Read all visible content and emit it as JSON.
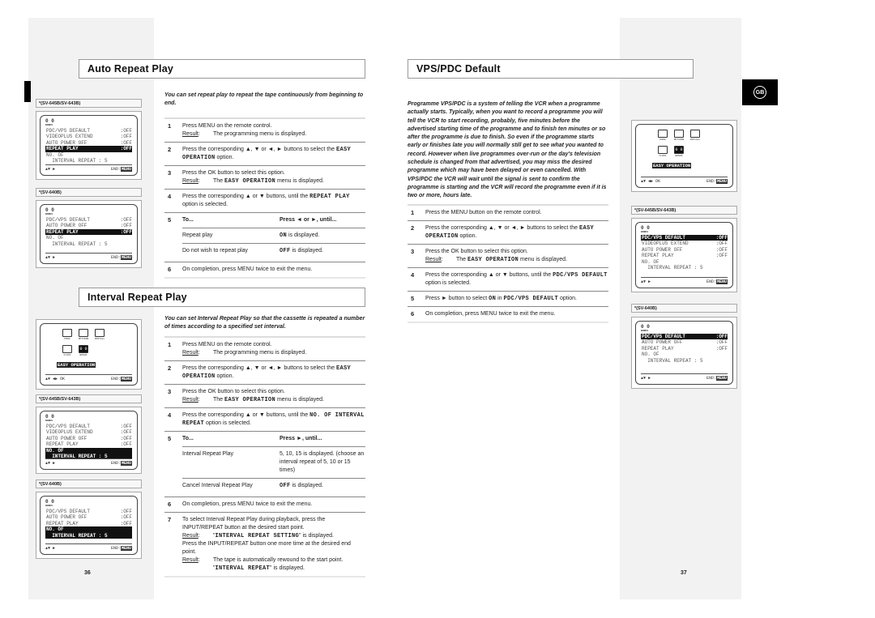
{
  "result_label": "Result",
  "left_page": {
    "page_number": "36",
    "auto_repeat": {
      "title": "Auto Repeat Play",
      "intro": "You can set repeat play to repeat the tape continuously from beginning to end.",
      "steps": [
        {
          "num": "1",
          "parts": [
            {
              "text": [
                "Press MENU on the remote control."
              ]
            },
            {
              "result": [
                "The programming menu is displayed."
              ]
            }
          ]
        },
        {
          "num": "2",
          "parts": [
            {
              "text": [
                "Press the corresponding ▲, ▼ or ◄, ► buttons to select the ",
                {
                  "m": "EASY OPERATION"
                },
                " option."
              ]
            }
          ]
        },
        {
          "num": "3",
          "parts": [
            {
              "text": [
                "Press the OK button to select this option."
              ]
            },
            {
              "result": [
                "The ",
                {
                  "m": "EASY OPERATION"
                },
                " menu is displayed."
              ]
            }
          ]
        },
        {
          "num": "4",
          "parts": [
            {
              "text": [
                "Press the corresponding ▲ or ▼ buttons, until the ",
                {
                  "m": "REPEAT PLAY"
                },
                " option is selected."
              ]
            }
          ]
        },
        {
          "num": "5",
          "table": {
            "head": [
              "To...",
              "Press ◄ or ►, until..."
            ],
            "rows": [
              [
                [
                  "Repeat play"
                ],
                [
                  {
                    "m": "ON"
                  },
                  " is displayed."
                ]
              ],
              [
                [
                  "Do not wish to repeat play"
                ],
                [
                  {
                    "m": "OFF"
                  },
                  " is displayed."
                ]
              ]
            ]
          }
        },
        {
          "num": "6",
          "parts": [
            {
              "text": [
                "On completion, press MENU twice to exit the menu."
              ]
            }
          ]
        }
      ],
      "screens": [
        {
          "label": "*(SV-645B/SV-643B)",
          "type": "menu",
          "rows": [
            [
              "PDC/VPS DEFAULT",
              ":OFF"
            ],
            [
              "VIDEOPLUS EXTEND",
              ":OFF"
            ],
            [
              "AUTO POWER OFF",
              ":OFF"
            ],
            [
              "REPEAT PLAY",
              ":OFF"
            ],
            [
              "NO. OF",
              ""
            ],
            [
              "  INTERVAL REPEAT : 5",
              ""
            ]
          ],
          "highlight": [
            3
          ]
        },
        {
          "label": "*(SV-640B)",
          "type": "menu",
          "rows": [
            [
              "PDC/VPS DEFAULT",
              ":OFF"
            ],
            [
              "AUTO POWER OFF",
              ":OFF"
            ],
            [
              "REPEAT PLAY",
              ":OFF"
            ],
            [
              "NO. OF",
              ""
            ],
            [
              "  INTERVAL REPEAT : 5",
              ""
            ]
          ],
          "highlight": [
            2
          ]
        }
      ]
    },
    "interval_repeat": {
      "title": "Interval Repeat Play",
      "intro": "You can set Interval Repeat Play so that the cassette is repeated a number of times according to a specified set interval.",
      "steps": [
        {
          "num": "1",
          "parts": [
            {
              "text": [
                "Press MENU on the remote control."
              ]
            },
            {
              "result": [
                "The programming menu is displayed."
              ]
            }
          ]
        },
        {
          "num": "2",
          "parts": [
            {
              "text": [
                "Press the corresponding ▲, ▼ or ◄, ► buttons to select the ",
                {
                  "m": "EASY OPERATION"
                },
                " option."
              ]
            }
          ]
        },
        {
          "num": "3",
          "parts": [
            {
              "text": [
                "Press the OK button to select this option."
              ]
            },
            {
              "result": [
                "The ",
                {
                  "m": "EASY OPERATION"
                },
                " menu is displayed."
              ]
            }
          ]
        },
        {
          "num": "4",
          "parts": [
            {
              "text": [
                "Press the corresponding ▲ or ▼ buttons, until the ",
                {
                  "m": "NO. OF INTERVAL REPEAT"
                },
                " option is selected."
              ]
            }
          ]
        },
        {
          "num": "5",
          "table": {
            "head": [
              "To...",
              "Press ►, until..."
            ],
            "rows": [
              [
                [
                  "Interval Repeat Play"
                ],
                [
                  "5, 10, 15 is displayed. (choose an interval repeat of 5, 10 or 15 times)"
                ]
              ],
              [
                [
                  "Cancel Interval Repeat Play"
                ],
                [
                  {
                    "m": "OFF"
                  },
                  " is displayed."
                ]
              ]
            ]
          }
        },
        {
          "num": "6",
          "parts": [
            {
              "text": [
                "On completion, press MENU twice to exit the menu."
              ]
            }
          ]
        },
        {
          "num": "7",
          "parts": [
            {
              "text": [
                "To select Interval Repeat Play during playback, press the INPUT/REPEAT button at the desired start point."
              ]
            },
            {
              "result": [
                "\"",
                {
                  "m": "INTERVAL REPEAT SETTING"
                },
                "\" is displayed."
              ]
            },
            {
              "text": [
                "Press the INPUT/REPEAT button one more time at the desired end point."
              ]
            },
            {
              "result": [
                "The tape is automatically rewound to the start point. \"",
                {
                  "m": "INTERVAL REPEAT"
                },
                "\" is displayed."
              ]
            }
          ]
        }
      ],
      "screens": [
        {
          "label": "",
          "type": "easy"
        },
        {
          "label": "*(SV-645B/SV-643B)",
          "type": "menu",
          "rows": [
            [
              "PDC/VPS DEFAULT",
              ":OFF"
            ],
            [
              "VIDEOPLUS EXTEND",
              ":OFF"
            ],
            [
              "AUTO POWER OFF",
              ":OFF"
            ],
            [
              "REPEAT PLAY",
              ":OFF"
            ],
            [
              "NO. OF",
              ""
            ],
            [
              "  INTERVAL REPEAT : 5",
              ""
            ]
          ],
          "highlight": [
            4,
            5
          ]
        },
        {
          "label": "*(SV-640B)",
          "type": "menu",
          "rows": [
            [
              "PDC/VPS DEFAULT",
              ":OFF"
            ],
            [
              "AUTO POWER OFF",
              ":OFF"
            ],
            [
              "REPEAT PLAY",
              ":OFF"
            ],
            [
              "NO. OF",
              ""
            ],
            [
              "  INTERVAL REPEAT : 5",
              ""
            ]
          ],
          "highlight": [
            3,
            4
          ]
        }
      ]
    }
  },
  "right_page": {
    "page_number": "37",
    "language_tab": "GB",
    "vps_pdc": {
      "title": "VPS/PDC Default",
      "intro": "Programme VPS/PDC is a system of telling the VCR when a programme actually starts. Typically, when you want to record a programme you will tell the VCR to start recording, probably, five minutes before the advertised starting time of the programme and to finish ten minutes or so after the programme is due to finish. So even if the programme starts early or finishes late you will normally still get to see what you wanted to record. However when live programmes over-run or the day's television schedule is changed from that advertised, you may miss the desired programme which may have been delayed or even cancelled. With VPS/PDC the VCR will wait until the signal is sent to confirm the programme is starting and the VCR will record the programme even if it is two or more, hours late.",
      "steps": [
        {
          "num": "1",
          "parts": [
            {
              "text": [
                "Press the MENU button on the remote control."
              ]
            }
          ]
        },
        {
          "num": "2",
          "parts": [
            {
              "text": [
                "Press the corresponding ▲, ▼ or ◄, ► buttons to select the ",
                {
                  "m": "EASY OPERATION"
                },
                " option."
              ]
            }
          ]
        },
        {
          "num": "3",
          "parts": [
            {
              "text": [
                "Press the OK button to select this option."
              ]
            },
            {
              "result": [
                "The ",
                {
                  "m": "EASY OPERATION"
                },
                " menu is displayed."
              ]
            }
          ]
        },
        {
          "num": "4",
          "parts": [
            {
              "text": [
                "Press the corresponding ▲ or ▼ buttons, until the ",
                {
                  "m": "PDC/VPS DEFAULT"
                },
                " option is selected."
              ]
            }
          ]
        },
        {
          "num": "5",
          "parts": [
            {
              "text": [
                "Press ► button to select ",
                {
                  "m": "ON"
                },
                " in ",
                {
                  "m": "PDC/VPS DEFAULT"
                },
                " option."
              ]
            }
          ]
        },
        {
          "num": "6",
          "parts": [
            {
              "text": [
                "On completion, press MENU twice to exit the menu."
              ]
            }
          ]
        }
      ],
      "screens": [
        {
          "label": "",
          "type": "easy"
        },
        {
          "label": "*(SV-645B/SV-643B)",
          "type": "menu",
          "rows": [
            [
              "PDC/VPS DEFAULT",
              ":OFF"
            ],
            [
              "VIDEOPLUS EXTEND",
              ":OFF"
            ],
            [
              "AUTO POWER OFF",
              ":OFF"
            ],
            [
              "REPEAT PLAY",
              ":OFF"
            ],
            [
              "NO. OF",
              ""
            ],
            [
              "  INTERVAL REPEAT : 5",
              ""
            ]
          ],
          "highlight": [
            0
          ]
        },
        {
          "label": "*(SV-640B)",
          "type": "menu",
          "rows": [
            [
              "PDC/VPS DEFAULT",
              ":OFF"
            ],
            [
              "AUTO POWER OFF",
              ":OFF"
            ],
            [
              "REPEAT PLAY",
              ":OFF"
            ],
            [
              "NO. OF",
              ""
            ],
            [
              "  INTERVAL REPEAT : 5",
              ""
            ]
          ],
          "highlight": [
            0
          ]
        }
      ]
    }
  },
  "screen_common": {
    "bonus_icon_text": "0 0",
    "bonus_label": "BONUS",
    "icons": [
      "PROG",
      "OPTIONS",
      "INSTALL",
      "CLOCK",
      "BONUS"
    ],
    "easy_operation": "EASY OPERATION",
    "nav_menu": "▲▼   ►",
    "nav_easy": "▲▼ ◄► OK",
    "end_label": "END:",
    "menu_key": "MENU"
  }
}
